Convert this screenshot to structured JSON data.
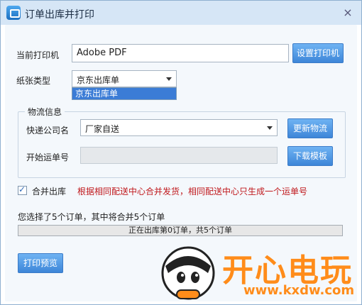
{
  "window": {
    "title": "订单出库并打印",
    "close_glyph": "×"
  },
  "printer": {
    "label": "当前打印机",
    "value": "Adobe PDF",
    "button": "设置打印机"
  },
  "paper": {
    "label": "纸张类型",
    "selected": "京东出库单",
    "dropdown_options": [
      "京东出库单"
    ]
  },
  "logistics": {
    "legend": "物流信息",
    "courier_label": "快递公司名",
    "courier_value": "厂家自送",
    "update_button": "更新物流",
    "start_no_label": "开始运单号",
    "start_no_value": "",
    "download_button": "下载模板"
  },
  "merge": {
    "checked": true,
    "label": "合并出库",
    "note": "根据相同配送中心合并发货，相同配送中心只生成一个运单号",
    "note_color": "#c0181c"
  },
  "status": {
    "summary": "您选择了5个订单，其中将合并5个订单",
    "progress_text": "正在出库第0订单，共5个订单",
    "progress_fraction": 0
  },
  "actions": {
    "preview_button": "打印预览"
  },
  "watermark": {
    "brand": "开心电玩",
    "url": "www.kxdw.com",
    "color": "#ff8c1a"
  }
}
